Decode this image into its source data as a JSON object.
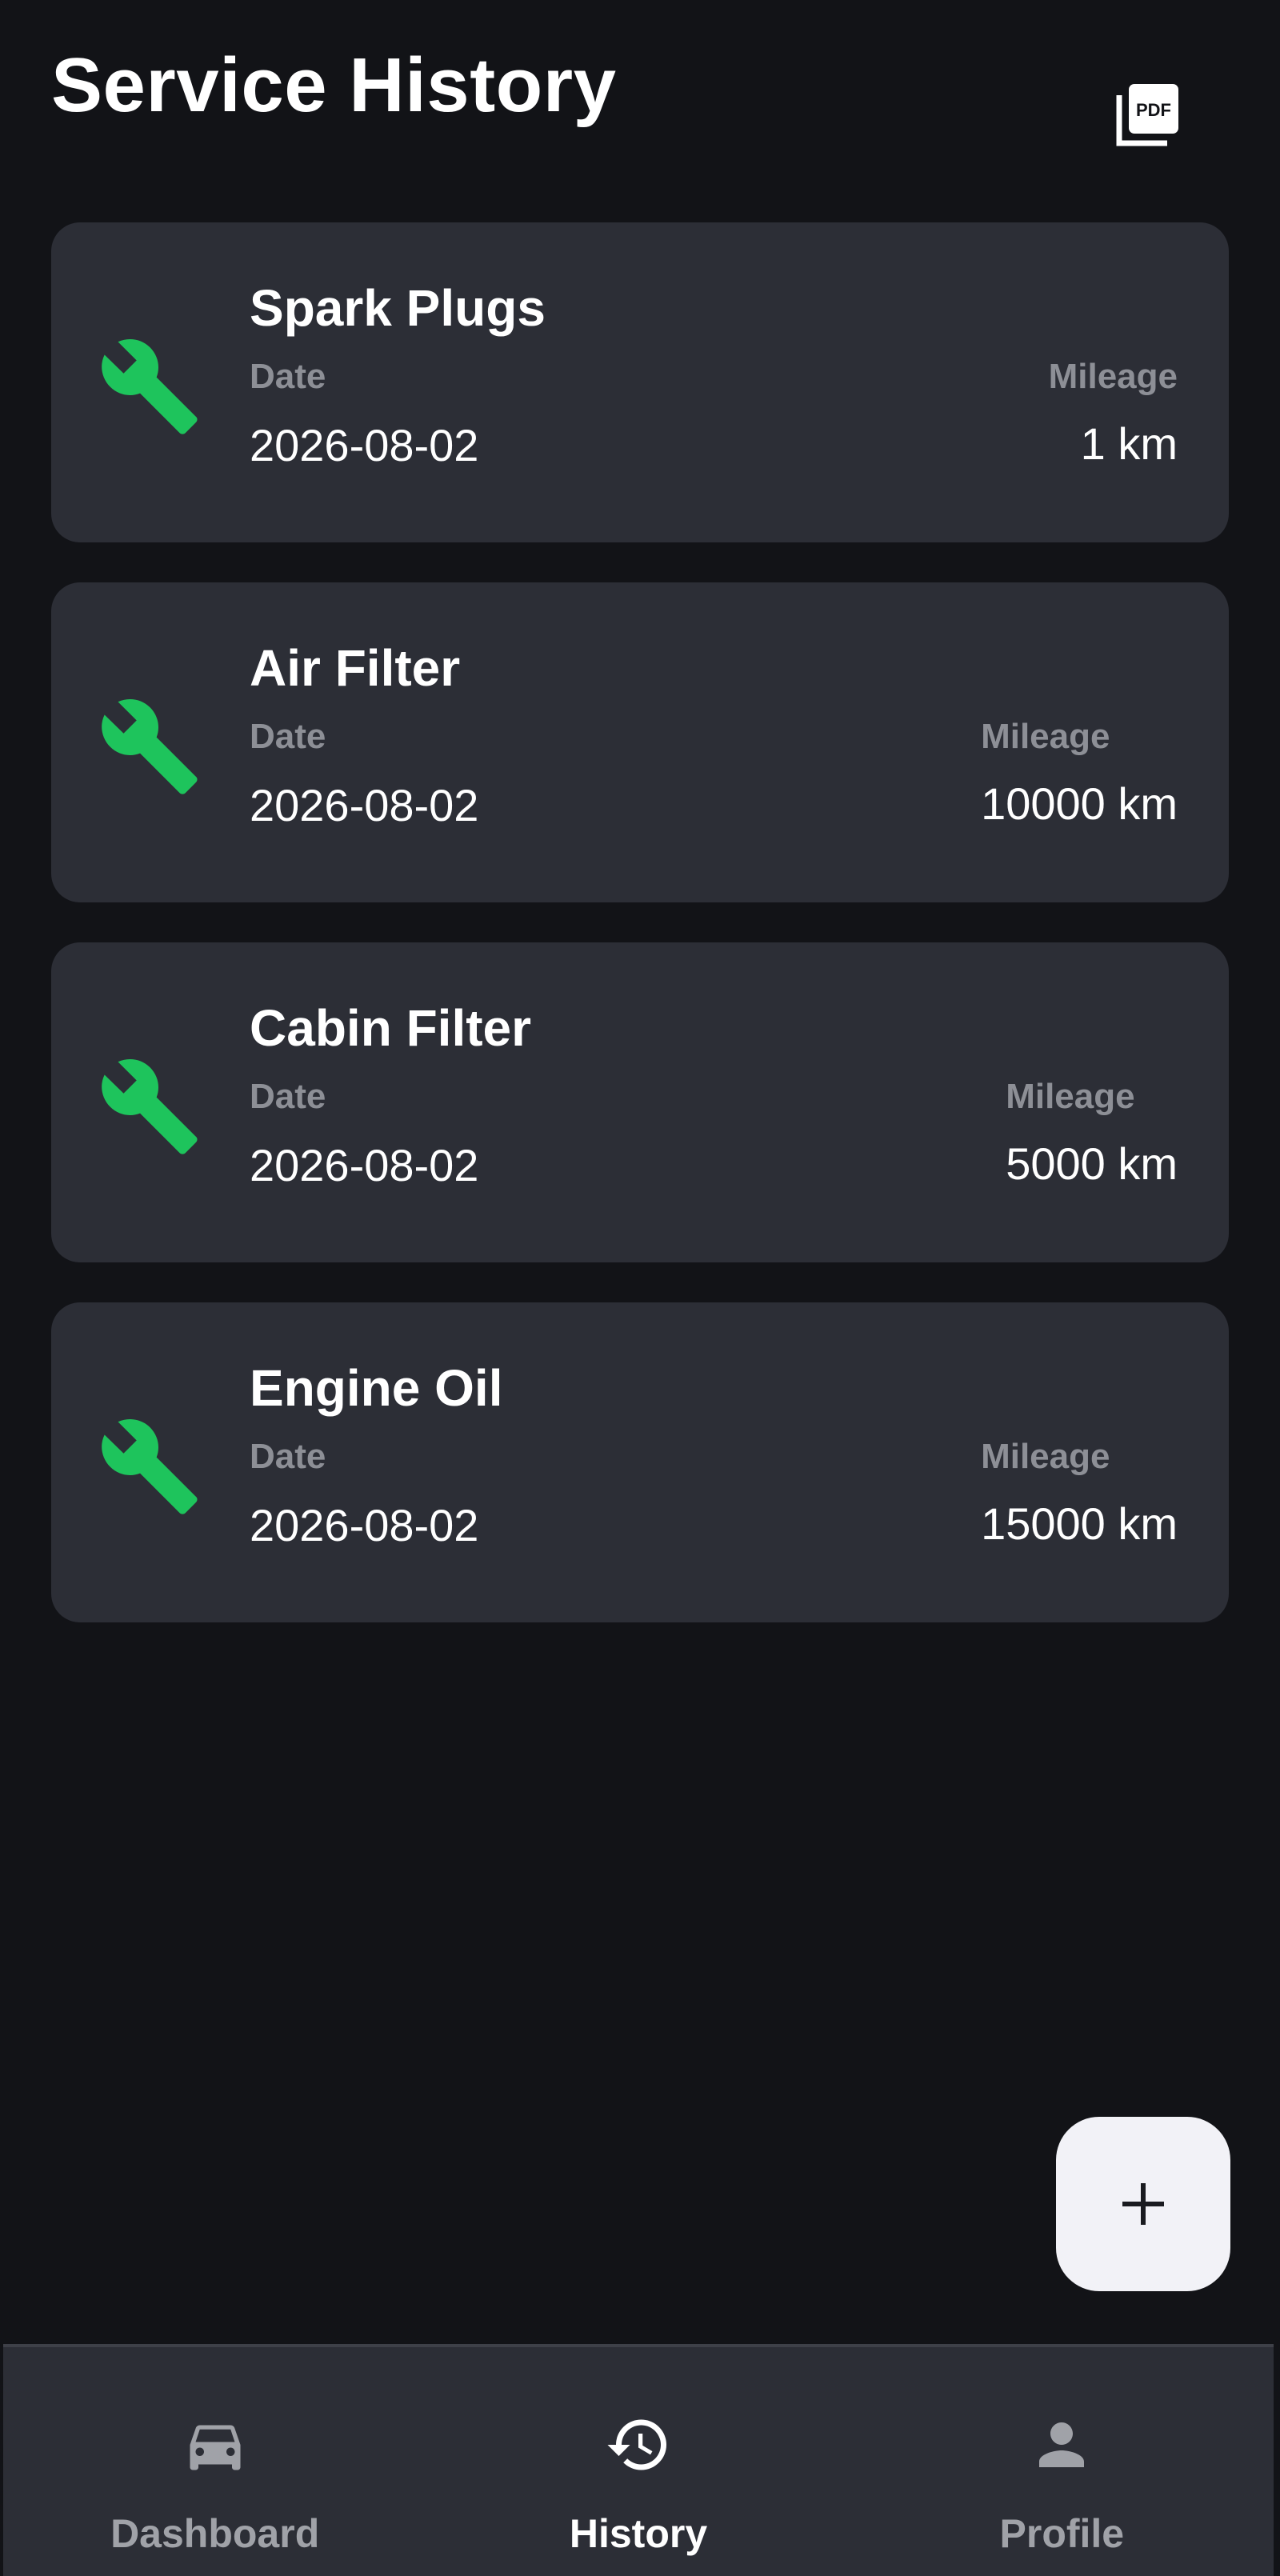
{
  "header": {
    "title": "Service History",
    "pdf_icon": "pdf-export-icon",
    "pdf_icon_text": "PDF"
  },
  "records": [
    {
      "title": "Spark Plugs",
      "date_label": "Date",
      "date": "2026-08-02",
      "mileage_label": "Mileage",
      "mileage": "1 km"
    },
    {
      "title": "Air Filter",
      "date_label": "Date",
      "date": "2026-08-02",
      "mileage_label": "Mileage",
      "mileage": "10000 km"
    },
    {
      "title": "Cabin Filter",
      "date_label": "Date",
      "date": "2026-08-02",
      "mileage_label": "Mileage",
      "mileage": "5000 km"
    },
    {
      "title": "Engine Oil",
      "date_label": "Date",
      "date": "2026-08-02",
      "mileage_label": "Mileage",
      "mileage": "15000 km"
    }
  ],
  "fab": {
    "icon": "plus-icon"
  },
  "nav": {
    "items": [
      {
        "label": "Dashboard",
        "icon": "car-icon",
        "active": false
      },
      {
        "label": "History",
        "icon": "history-icon",
        "active": true
      },
      {
        "label": "Profile",
        "icon": "person-icon",
        "active": false
      }
    ]
  },
  "colors": {
    "background": "#121317",
    "card": "#2c2e36",
    "accent_green": "#1ec45c",
    "muted_text": "#8d8f96",
    "fab_background": "#f2f2f7"
  }
}
